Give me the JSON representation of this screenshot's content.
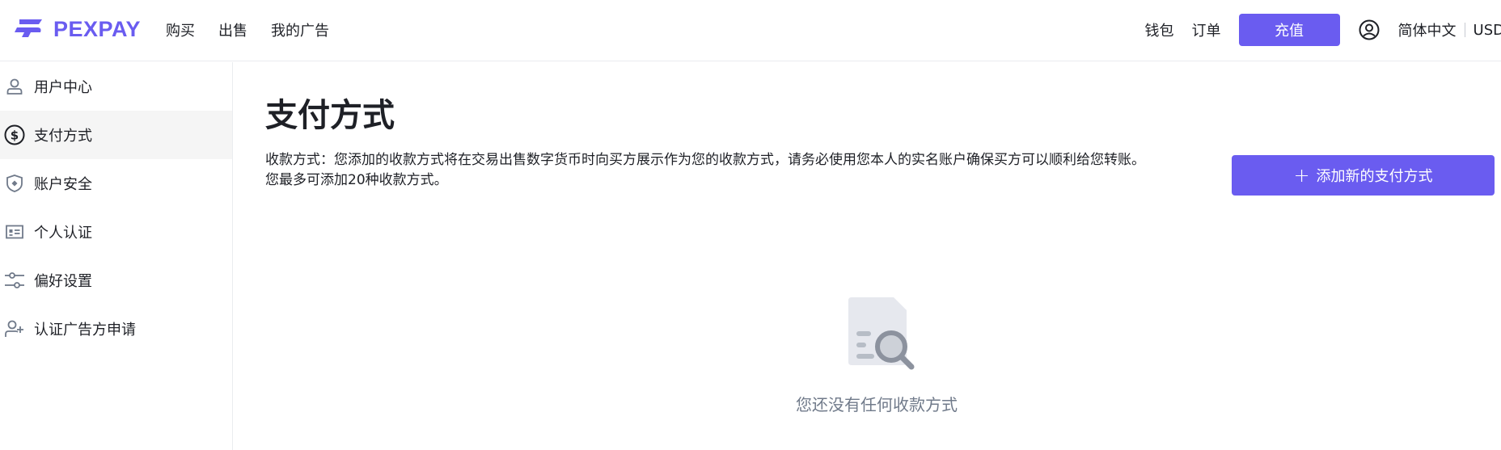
{
  "brand": {
    "name": "PEXPAY",
    "accent": "#6a5cf0"
  },
  "nav": {
    "left": [
      "购买",
      "出售",
      "我的广告"
    ],
    "wallet": "钱包",
    "orders": "订单",
    "recharge": "充值",
    "language": "简体中文",
    "currency": "USD"
  },
  "sidebar": {
    "items": [
      {
        "label": "用户中心",
        "icon": "user-icon"
      },
      {
        "label": "支付方式",
        "icon": "dollar-circle-icon",
        "active": true
      },
      {
        "label": "账户安全",
        "icon": "shield-icon"
      },
      {
        "label": "个人认证",
        "icon": "id-card-icon"
      },
      {
        "label": "偏好设置",
        "icon": "sliders-icon"
      },
      {
        "label": "认证广告方申请",
        "icon": "user-plus-icon"
      }
    ]
  },
  "main": {
    "title": "支付方式",
    "description": "收款方式：您添加的收款方式将在交易出售数字货币时向买方展示作为您的收款方式，请务必使用您本人的实名账户确保买方可以顺利给您转账。您最多可添加20种收款方式。",
    "add_button": "添加新的支付方式",
    "empty_text": "您还没有任何收款方式"
  }
}
